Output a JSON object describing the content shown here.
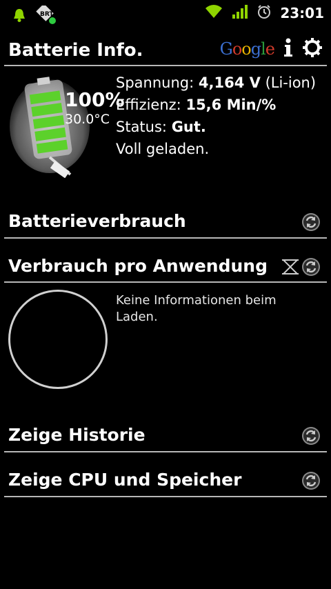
{
  "statusbar": {
    "time": "23:01",
    "icons": [
      "bell-icon",
      "notification-app-icon",
      "wifi-icon",
      "signal-icon",
      "alarm-icon"
    ],
    "accent": "#8fd400"
  },
  "header": {
    "title": "Batterie Info.",
    "google_label": "Google",
    "icons": [
      "google-logo",
      "info-icon",
      "settings-icon"
    ]
  },
  "battery": {
    "percent": "100%",
    "level_fraction": 1.0,
    "temperature": "30.0°C",
    "voltage_label": "Spannung:",
    "voltage_value": "4,164 V",
    "chemistry": "(Li-ion)",
    "efficiency_label": "Effizienz:",
    "efficiency_value": "15,6 Min/%",
    "status_label": "Status:",
    "status_value": "Gut.",
    "charge_state": "Voll geladen."
  },
  "sections": {
    "usage": "Batterieverbrauch",
    "per_app": "Verbrauch pro Anwendung",
    "per_app_empty": "Keine Informationen beim Laden.",
    "history": "Zeige Historie",
    "cpu_memory": "Zeige CPU und Speicher"
  },
  "colors": {
    "background": "#000000",
    "divider": "#b8b8b8",
    "battery_green": "#5cd12b"
  }
}
